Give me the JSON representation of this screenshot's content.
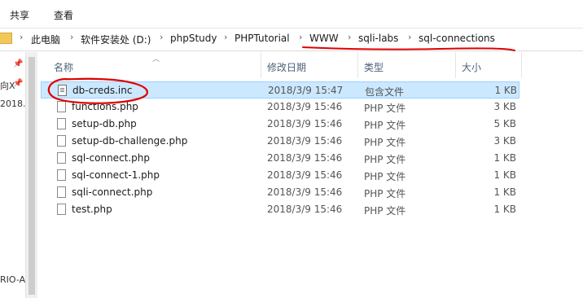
{
  "ribbon": {
    "tabs": [
      "共享",
      "查看"
    ]
  },
  "address": {
    "segments": [
      "此电脑",
      "软件安装处 (D:)",
      "phpStudy",
      "PHPTutorial",
      "WWW",
      "sqli-labs",
      "sql-connections"
    ]
  },
  "left_pane": {
    "fragments": [
      "向X",
      "2018.",
      "RIO-A"
    ]
  },
  "columns": {
    "name": "名称",
    "date": "修改日期",
    "type": "类型",
    "size": "大小"
  },
  "files": [
    {
      "name": "db-creds.inc",
      "date": "2018/3/9 15:47",
      "type": "包含文件",
      "size": "1 KB",
      "selected": true,
      "icon": "inc-file-icon"
    },
    {
      "name": "functions.php",
      "date": "2018/3/9 15:46",
      "type": "PHP 文件",
      "size": "3 KB",
      "icon": "php-file-icon"
    },
    {
      "name": "setup-db.php",
      "date": "2018/3/9 15:46",
      "type": "PHP 文件",
      "size": "5 KB",
      "icon": "php-file-icon"
    },
    {
      "name": "setup-db-challenge.php",
      "date": "2018/3/9 15:46",
      "type": "PHP 文件",
      "size": "3 KB",
      "icon": "php-file-icon"
    },
    {
      "name": "sql-connect.php",
      "date": "2018/3/9 15:46",
      "type": "PHP 文件",
      "size": "1 KB",
      "icon": "php-file-icon"
    },
    {
      "name": "sql-connect-1.php",
      "date": "2018/3/9 15:46",
      "type": "PHP 文件",
      "size": "1 KB",
      "icon": "php-file-icon"
    },
    {
      "name": "sqli-connect.php",
      "date": "2018/3/9 15:46",
      "type": "PHP 文件",
      "size": "1 KB",
      "icon": "php-file-icon"
    },
    {
      "name": "test.php",
      "date": "2018/3/9 15:46",
      "type": "PHP 文件",
      "size": "1 KB",
      "icon": "php-file-icon"
    }
  ],
  "colors": {
    "selection": "#cce8ff",
    "annotation_red": "#e00000"
  }
}
